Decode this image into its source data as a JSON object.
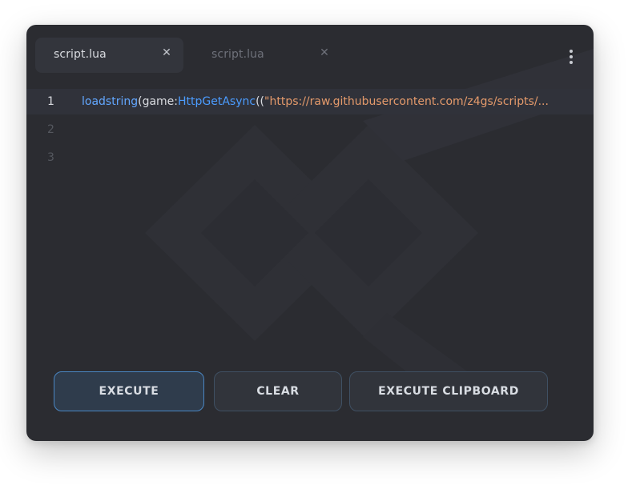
{
  "tabs": [
    {
      "label": "script.lua",
      "close": "✕",
      "active": true
    },
    {
      "label": "script.lua",
      "close": "✕",
      "active": false
    }
  ],
  "menu": {
    "icon": "vertical-dots-icon"
  },
  "editor": {
    "lines": [
      {
        "number": "1",
        "tokens": {
          "fn": "loadstring",
          "open": "(game:",
          "method": "HttpGetAsync",
          "paren": "((",
          "str": "\"https://raw.githubusercontent.com/z4gs/scripts/..."
        }
      },
      {
        "number": "2"
      },
      {
        "number": "3"
      }
    ]
  },
  "buttons": {
    "execute": "EXECUTE",
    "clear": "CLEAR",
    "execute_clipboard": "EXECUTE CLIPBOARD"
  },
  "colors": {
    "window_bg": "#2b2c31",
    "accent": "#4a86c2",
    "function": "#62a7ff",
    "string": "#e49a6b"
  }
}
